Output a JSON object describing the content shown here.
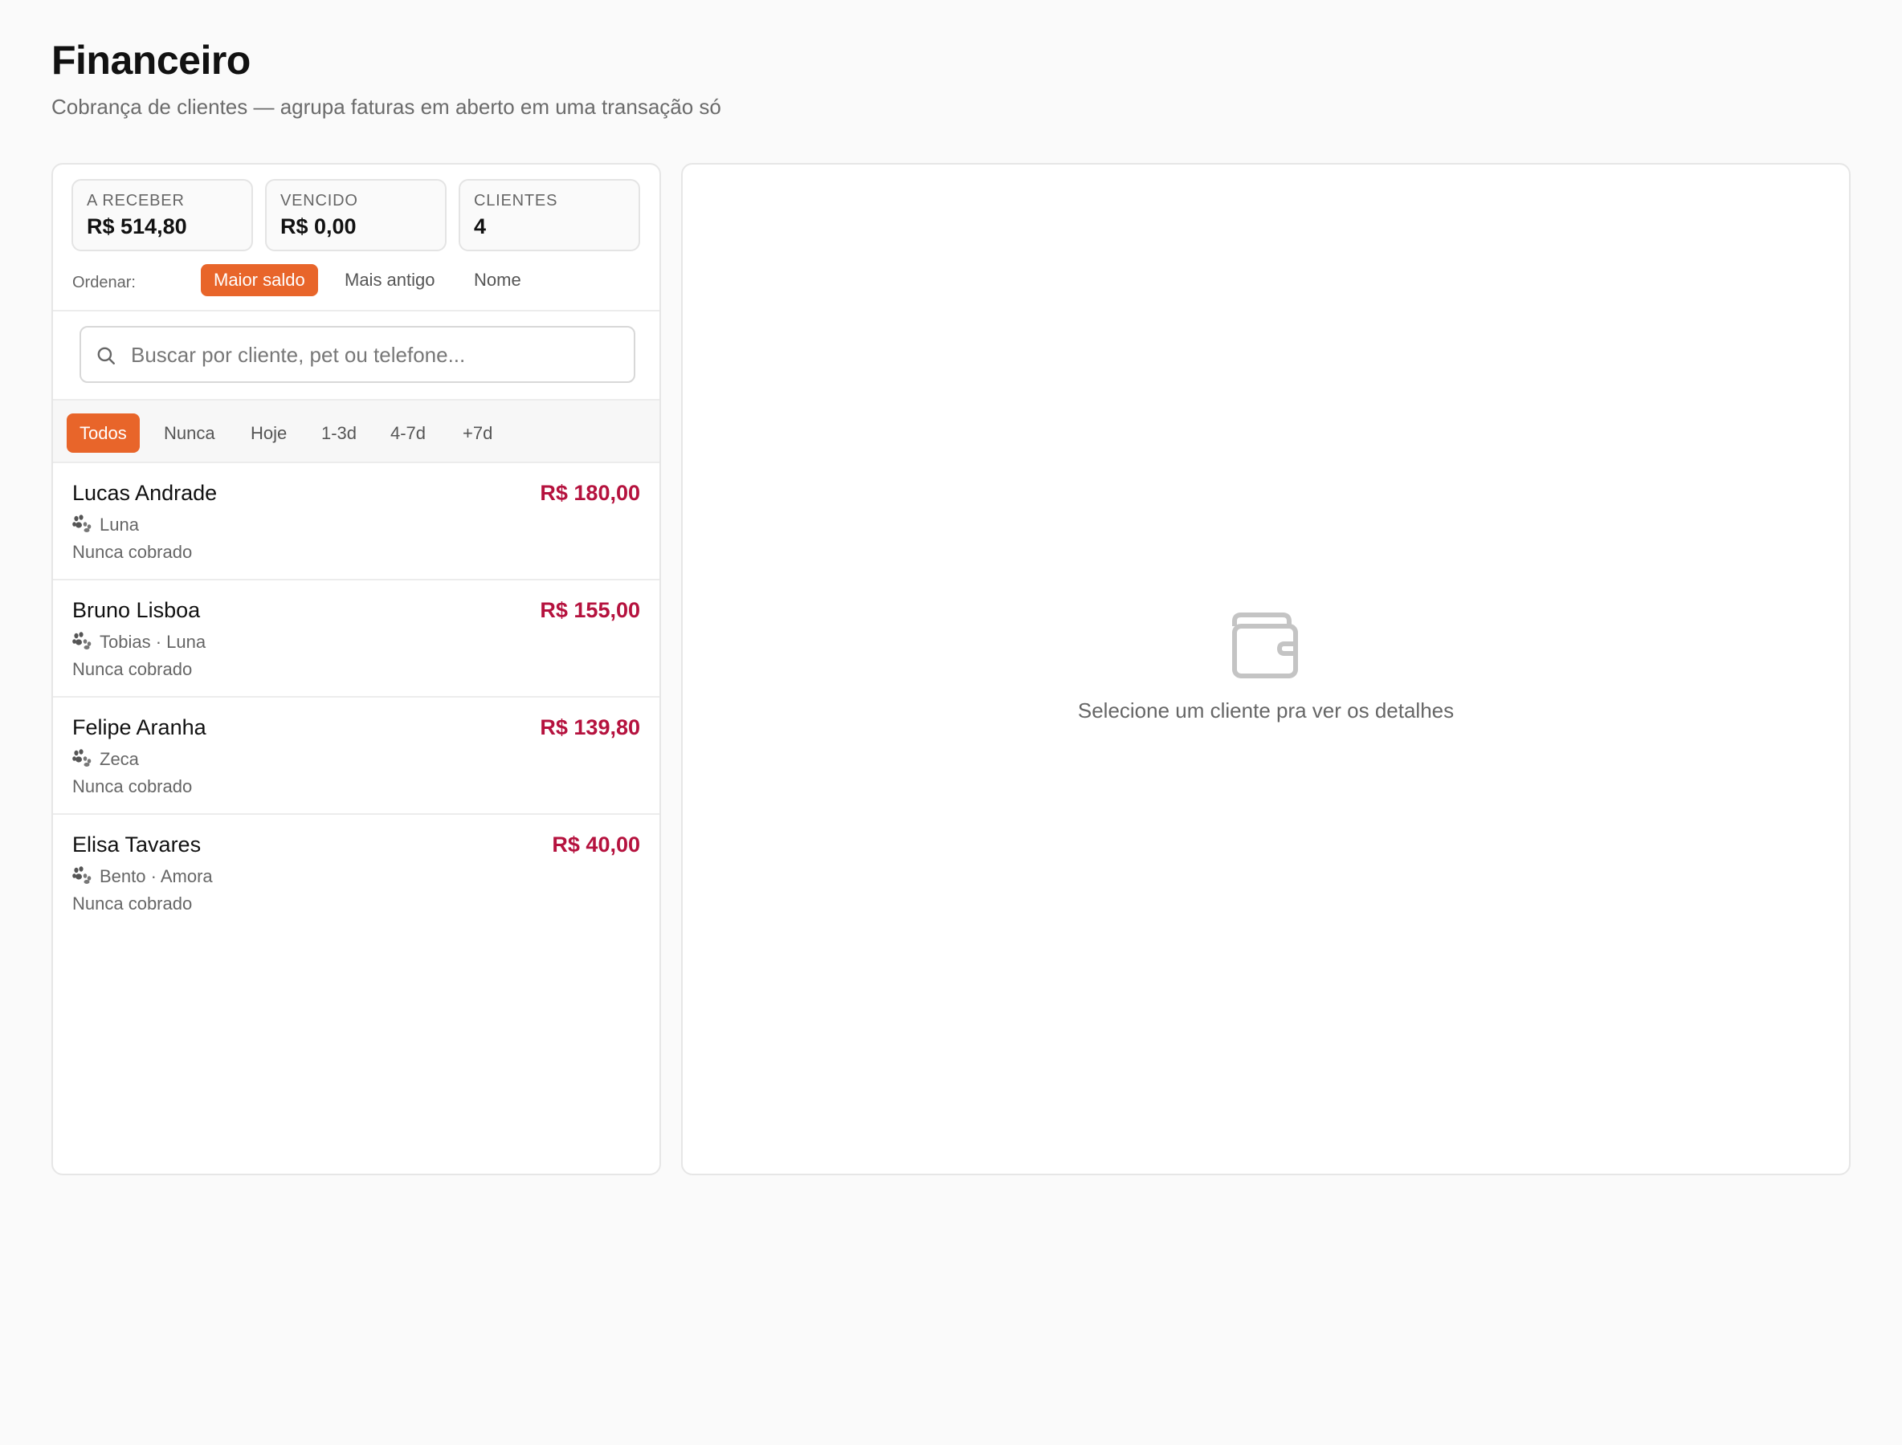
{
  "header": {
    "title": "Financeiro",
    "subtitle": "Cobrança de clientes — agrupa faturas em aberto em uma transação só"
  },
  "stats": [
    {
      "label": "A RECEBER",
      "value": "R$ 514,80"
    },
    {
      "label": "VENCIDO",
      "value": "R$ 0,00"
    },
    {
      "label": "CLIENTES",
      "value": "4"
    }
  ],
  "sort": {
    "label": "Ordenar:",
    "options": [
      "Maior saldo",
      "Mais antigo",
      "Nome"
    ],
    "active": "Maior saldo"
  },
  "search": {
    "placeholder": "Buscar por cliente, pet ou telefone...",
    "value": ""
  },
  "filters": {
    "options": [
      "Todos",
      "Nunca",
      "Hoje",
      "1-3d",
      "4-7d",
      "+7d"
    ],
    "active": "Todos"
  },
  "clients": [
    {
      "name": "Lucas Andrade",
      "amount": "R$ 180,00",
      "pets": "Luna",
      "status": "Nunca cobrado"
    },
    {
      "name": "Bruno Lisboa",
      "amount": "R$ 155,00",
      "pets": "Tobias · Luna",
      "status": "Nunca cobrado"
    },
    {
      "name": "Felipe Aranha",
      "amount": "R$ 139,80",
      "pets": "Zeca",
      "status": "Nunca cobrado"
    },
    {
      "name": "Elisa Tavares",
      "amount": "R$ 40,00",
      "pets": "Bento · Amora",
      "status": "Nunca cobrado"
    }
  ],
  "detail": {
    "empty_icon": "wallet-icon",
    "empty_text": "Selecione um cliente pra ver os detalhes"
  },
  "colors": {
    "accent": "#e8652a",
    "amount": "#b5123e",
    "background": "#fafafa"
  }
}
